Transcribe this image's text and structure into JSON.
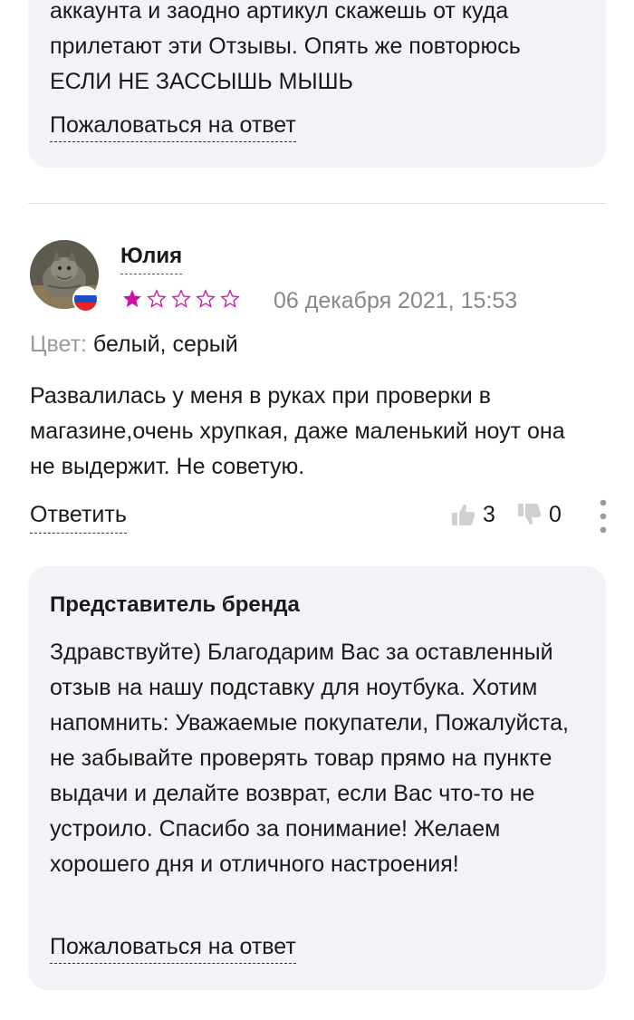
{
  "prev_reply": {
    "text": "аккаунта и заодно артикул скажешь от куда прилетают эти Отзывы. Опять же повторюсь ЕСЛИ НЕ ЗАССЫШЬ МЫШЬ",
    "report_label": "Пожаловаться на ответ"
  },
  "review": {
    "author": "Юлия",
    "country_flag": "russia-flag",
    "rating": 1,
    "rating_max": 5,
    "star_color": "#cb11ab",
    "date": "06 декабря 2021, 15:53",
    "color_label": "Цвет:",
    "color_value": "белый, серый",
    "text": "Развалилась у меня в руках при проверки в магазине,очень хрупкая, даже маленький ноут она не выдержит. Не советую.",
    "answer_label": "Ответить",
    "likes": "3",
    "dislikes": "0"
  },
  "brand_reply": {
    "title": "Представитель бренда",
    "text": "Здравствуйте) Благодарим Вас за оставленный отзыв на нашу подставку для ноутбука. Хотим напомнить: Уважаемые покупатели, Пожалуйста, не забывайте проверять товар прямо на пункте выдачи и делайте возврат, если Вас что-то не устроило. Спасибо за понимание! Желаем хорошего дня и отличного настроения!",
    "report_label": "Пожаловаться на ответ"
  }
}
